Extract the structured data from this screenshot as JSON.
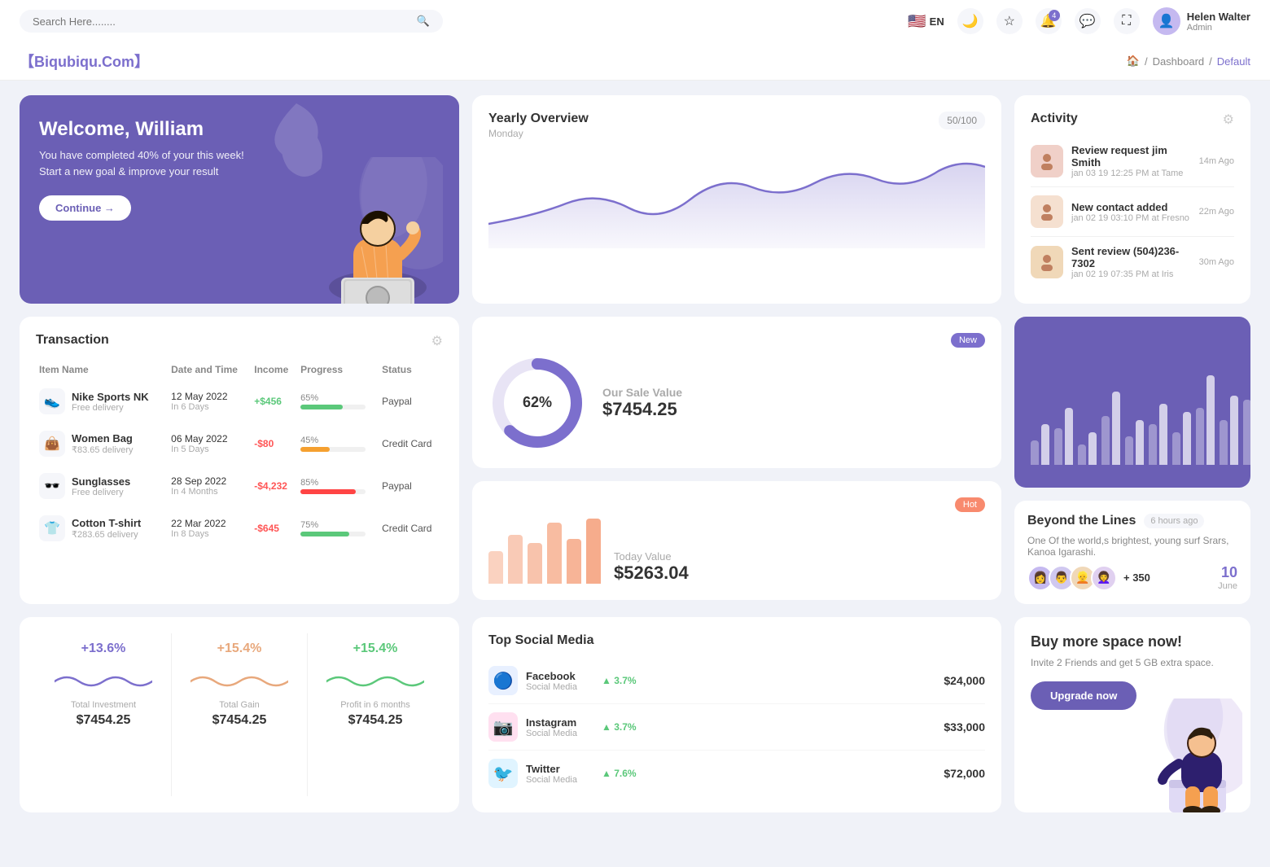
{
  "topnav": {
    "search_placeholder": "Search Here........",
    "lang": "EN",
    "notification_count": "4",
    "user_name": "Helen Walter",
    "user_role": "Admin"
  },
  "breadcrumb": {
    "brand": "【Biqubiqu.Com】",
    "home": "⌂",
    "dashboard": "Dashboard",
    "current": "Default"
  },
  "welcome": {
    "title": "Welcome, William",
    "subtitle": "You have completed 40% of your this week! Start a new goal & improve your result",
    "button": "Continue →"
  },
  "yearly": {
    "title": "Yearly Overview",
    "subtitle": "Monday",
    "badge": "50/100"
  },
  "activity": {
    "title": "Activity",
    "items": [
      {
        "title": "Review request jim Smith",
        "sub": "jan 03 19 12:25 PM at Tame",
        "time": "14m Ago",
        "color": "#f0d0c8"
      },
      {
        "title": "New contact added",
        "sub": "jan 02 19 03:10 PM at Fresno",
        "time": "22m Ago",
        "color": "#f5e0d0"
      },
      {
        "title": "Sent review (504)236-7302",
        "sub": "jan 02 19 07:35 PM at Iris",
        "time": "30m Ago",
        "color": "#f0d8b8"
      }
    ]
  },
  "transaction": {
    "title": "Transaction",
    "headers": [
      "Item Name",
      "Date and Time",
      "Income",
      "Progress",
      "Status"
    ],
    "rows": [
      {
        "name": "Nike Sports NK",
        "sub": "Free delivery",
        "date": "12 May 2022",
        "date_sub": "In 6 Days",
        "income": "+$456",
        "income_type": "pos",
        "progress": 65,
        "progress_color": "#5bc87a",
        "status": "Paypal",
        "icon": "👟"
      },
      {
        "name": "Women Bag",
        "sub": "₹83.65 delivery",
        "date": "06 May 2022",
        "date_sub": "In 5 Days",
        "income": "-$80",
        "income_type": "neg",
        "progress": 45,
        "progress_color": "#f5a030",
        "status": "Credit Card",
        "icon": "👜"
      },
      {
        "name": "Sunglasses",
        "sub": "Free delivery",
        "date": "28 Sep 2022",
        "date_sub": "In 4 Months",
        "income": "-$4,232",
        "income_type": "neg",
        "progress": 85,
        "progress_color": "#f44",
        "status": "Paypal",
        "icon": "🕶️"
      },
      {
        "name": "Cotton T-shirt",
        "sub": "₹283.65 delivery",
        "date": "22 Mar 2022",
        "date_sub": "In 8 Days",
        "income": "-$645",
        "income_type": "neg",
        "progress": 75,
        "progress_color": "#5bc87a",
        "status": "Credit Card",
        "icon": "👕"
      }
    ]
  },
  "sale_value": {
    "title": "Our Sale Value",
    "value": "$7454.25",
    "percent": "62%",
    "badge": "New"
  },
  "today_value": {
    "title": "Today Value",
    "value": "$5263.04",
    "badge": "Hot",
    "bars": [
      40,
      60,
      50,
      75,
      55,
      80
    ]
  },
  "big_chart": {
    "title": "Beyond the Lines",
    "time_ago": "6 hours ago",
    "desc": "One Of the world,s brightest, young surf Srars, Kanoa Igarashi.",
    "plus_count": "+ 350",
    "date": "10",
    "month": "June"
  },
  "stats": [
    {
      "percent": "+13.6%",
      "label": "Total Investment",
      "value": "$7454.25",
      "color": "#7c6fcd"
    },
    {
      "percent": "+15.4%",
      "label": "Total Gain",
      "value": "$7454.25",
      "color": "#e8a87c"
    },
    {
      "percent": "+15.4%",
      "label": "Profit in 6 months",
      "value": "$7454.25",
      "color": "#5bc87a"
    }
  ],
  "social": {
    "title": "Top Social Media",
    "items": [
      {
        "name": "Facebook",
        "sub": "Social Media",
        "growth": "3.7%",
        "value": "$24,000",
        "color": "#1877f2",
        "icon": "f"
      },
      {
        "name": "Instagram",
        "sub": "Social Media",
        "growth": "3.7%",
        "value": "$33,000",
        "color": "#e1306c",
        "icon": "📷"
      },
      {
        "name": "Twitter",
        "sub": "Social Media",
        "growth": "7.6%",
        "value": "$72,000",
        "color": "#1da1f2",
        "icon": "🐦"
      }
    ]
  },
  "upgrade": {
    "title": "Buy more space now!",
    "desc": "Invite 2 Friends and get 5 GB extra space.",
    "button": "Upgrade now"
  }
}
